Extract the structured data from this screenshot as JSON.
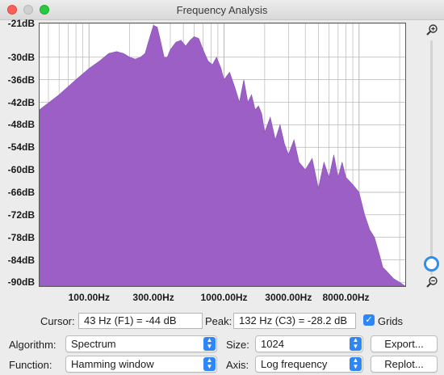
{
  "window": {
    "title": "Frequency Analysis"
  },
  "colors": {
    "spectrum_fill": "#9b5fc6",
    "grid_line": "#b8b8b8",
    "accent": "#2f86f6"
  },
  "chart_data": {
    "type": "area",
    "x_scale": "log",
    "xlim": [
      43,
      22000
    ],
    "ylim": [
      -91,
      -21
    ],
    "xticks": [
      {
        "value": 100,
        "label": "100.00Hz"
      },
      {
        "value": 300,
        "label": "300.00Hz"
      },
      {
        "value": 1000,
        "label": "1000.00Hz"
      },
      {
        "value": 3000,
        "label": "3000.00Hz"
      },
      {
        "value": 8000,
        "label": "8000.00Hz"
      }
    ],
    "yticks": [
      "-21dB",
      "-30dB",
      "-36dB",
      "-42dB",
      "-48dB",
      "-54dB",
      "-60dB",
      "-66dB",
      "-72dB",
      "-78dB",
      "-84dB",
      "-90dB"
    ],
    "grid": true,
    "x": [
      43,
      60,
      80,
      100,
      120,
      140,
      160,
      180,
      200,
      220,
      240,
      260,
      280,
      300,
      320,
      340,
      360,
      380,
      400,
      440,
      480,
      520,
      560,
      600,
      650,
      700,
      760,
      820,
      880,
      950,
      1000,
      1100,
      1200,
      1300,
      1400,
      1500,
      1600,
      1700,
      1800,
      1900,
      2000,
      2200,
      2400,
      2600,
      2800,
      3000,
      3300,
      3600,
      4000,
      4500,
      5000,
      5500,
      6000,
      6500,
      7000,
      7500,
      8000,
      9000,
      10000,
      11000,
      12000,
      13000,
      14000,
      15000,
      16000,
      18000,
      20000,
      22000
    ],
    "values": [
      -44,
      -40,
      -36,
      -33,
      -31,
      -29,
      -28.5,
      -29,
      -30,
      -30.5,
      -30,
      -29,
      -25,
      -21.5,
      -22,
      -26,
      -30,
      -30,
      -28,
      -26,
      -25.5,
      -27,
      -25.5,
      -24.5,
      -25,
      -28,
      -31,
      -32,
      -30,
      -33,
      -36,
      -34,
      -38,
      -42,
      -36,
      -42,
      -40,
      -44,
      -43,
      -45,
      -50,
      -46,
      -52,
      -48,
      -53,
      -56,
      -52,
      -58,
      -60,
      -57,
      -65,
      -58,
      -62,
      -56,
      -62,
      -58,
      -62,
      -64,
      -66,
      -72,
      -76,
      -78,
      -82,
      -86,
      -87,
      -89,
      -90,
      -91
    ]
  },
  "zoom": {
    "level": 0.05
  },
  "cursor": {
    "label": "Cursor:",
    "value": "43 Hz (F1) = -44 dB"
  },
  "peak": {
    "label": "Peak:",
    "value": "132 Hz (C3) = -28.2 dB"
  },
  "grids": {
    "label": "Grids",
    "checked": true
  },
  "algorithm": {
    "label": "Algorithm:",
    "value": "Spectrum"
  },
  "size": {
    "label": "Size:",
    "value": "1024"
  },
  "function": {
    "label": "Function:",
    "value": "Hamming window"
  },
  "axis": {
    "label": "Axis:",
    "value": "Log frequency"
  },
  "buttons": {
    "export": "Export...",
    "replot": "Replot..."
  }
}
